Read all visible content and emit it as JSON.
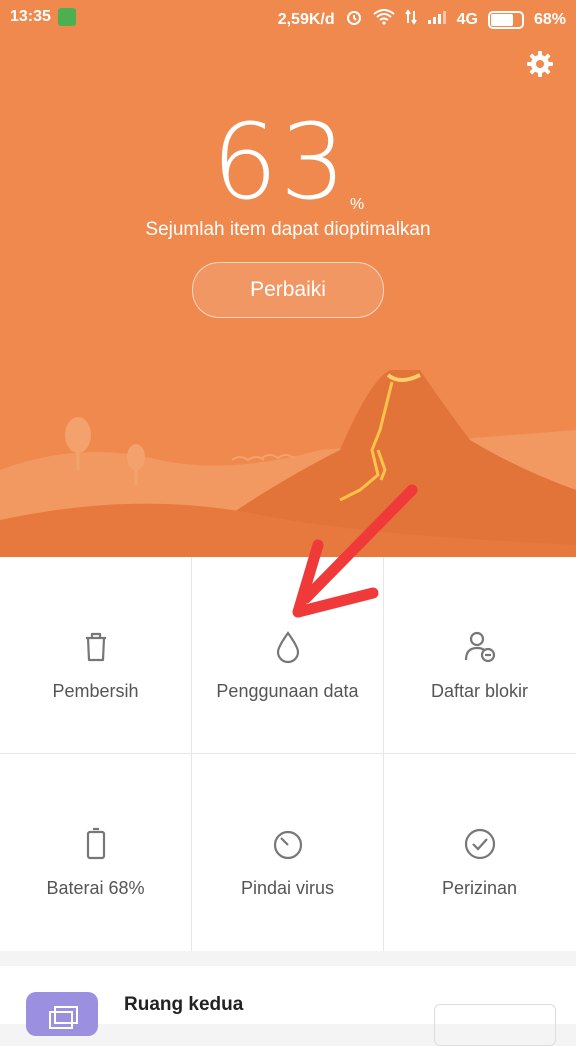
{
  "status_bar": {
    "time": "13:35",
    "network_speed": "2,59K/d",
    "network_type": "4G",
    "battery": "68%",
    "battery_level": 0.68
  },
  "hero": {
    "score": "63",
    "score_unit": "%",
    "subtitle": "Sejumlah item dapat dioptimalkan",
    "fix_button": "Perbaiki",
    "background_color": "#f0894e"
  },
  "tools": [
    {
      "label": "Pembersih",
      "icon": "trash-icon"
    },
    {
      "label": "Penggunaan data",
      "icon": "drop-icon"
    },
    {
      "label": "Daftar blokir",
      "icon": "block-user-icon"
    },
    {
      "label": "Baterai 68%",
      "icon": "battery-icon"
    },
    {
      "label": "Pindai virus",
      "icon": "scan-icon"
    },
    {
      "label": "Perizinan",
      "icon": "check-circle-icon"
    }
  ],
  "bottom_card": {
    "title": "Ruang kedua",
    "icon": "dual-space-icon",
    "icon_color": "#9b8fe0"
  },
  "annotation": {
    "arrow_color": "#f03a3a"
  }
}
